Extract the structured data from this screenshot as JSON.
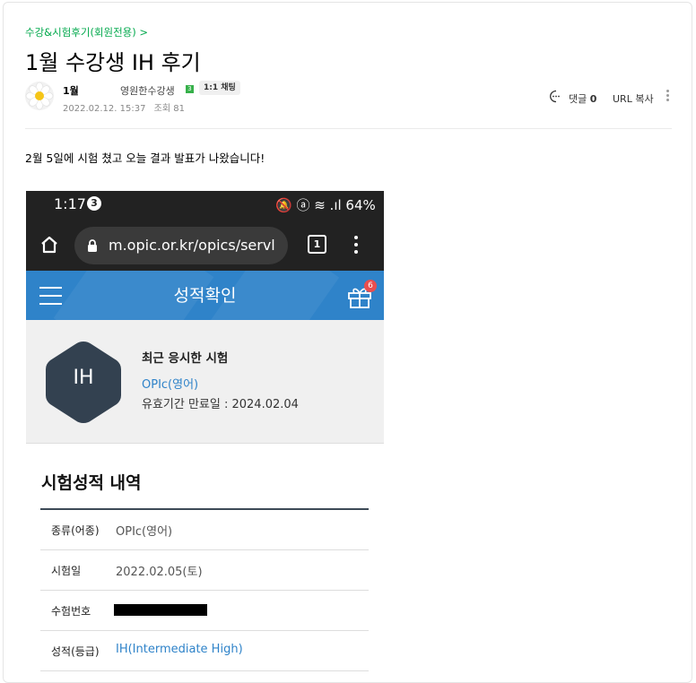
{
  "post": {
    "breadcrumb": "수강&시험후기(회원전용) >",
    "title": "1월 수강생 IH 후기",
    "author": "1월",
    "member_grade": "영원한수강생",
    "grade_badge": "3",
    "chat_badge": "1:1 채팅",
    "date": "2022.02.12. 15:37",
    "views": "조회 81",
    "comments_label": "댓글",
    "comments_count": "0",
    "url_copy": "URL 복사",
    "body_text": "2월 5일에 시험 쳤고 오늘 결과 발표가 나왔습니다!"
  },
  "phone": {
    "status_time": "1:17",
    "status_badge": "3",
    "status_right": "🔕 ⓐ ≋ .ıl 64%",
    "url": "m.opic.or.kr/opics/servl",
    "tab_count": "1",
    "header_title": "성적확인",
    "gift_count": "6",
    "recent_grade": "IH",
    "recent_title": "최근 응시한 시험",
    "recent_exam": "OPIc(영어)",
    "recent_expiry": "유효기간 만료일 : 2024.02.04",
    "section_title": "시험성적 내역",
    "rows": [
      {
        "label": "종류(어종)",
        "value": "OPIc(영어)"
      },
      {
        "label": "시험일",
        "value": "2022.02.05(토)"
      },
      {
        "label": "수험번호",
        "value": ""
      },
      {
        "label": "성적(등급)",
        "value": "IH(Intermediate High)"
      }
    ]
  },
  "colors": {
    "breadcrumb": "#03a94d",
    "app_header": "#2f83c9",
    "hex_badge": "#334150",
    "link_blue": "#2f83c9"
  }
}
